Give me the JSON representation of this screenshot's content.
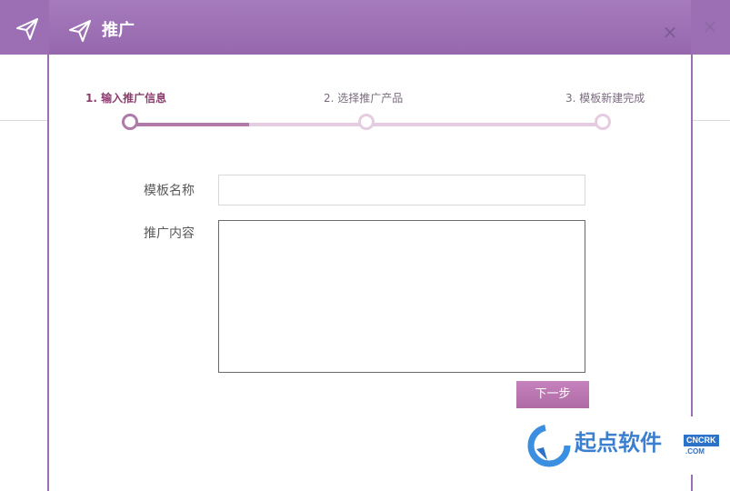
{
  "outer_window": {
    "icon": "send-icon",
    "close_label": "×"
  },
  "dialog": {
    "title": "推广",
    "icon": "send-icon",
    "close_label": "×"
  },
  "steps": [
    {
      "label": "1. 输入推广信息",
      "state": "active"
    },
    {
      "label": "2. 选择推广产品",
      "state": "pending"
    },
    {
      "label": "3. 模板新建完成",
      "state": "pending"
    }
  ],
  "progress": {
    "fraction_complete": 0.25
  },
  "form": {
    "template_name_label": "模板名称",
    "template_name_value": "",
    "content_label": "推广内容",
    "content_value": "",
    "next_label": "下一步"
  },
  "watermark": {
    "text": "起点软件",
    "badge": "CNCRK",
    "domain": ".COM"
  },
  "colors": {
    "accent": "#9c6fb4",
    "step_active": "#b07aa8",
    "step_pending": "#e6cce0",
    "button": "#b874b0"
  }
}
